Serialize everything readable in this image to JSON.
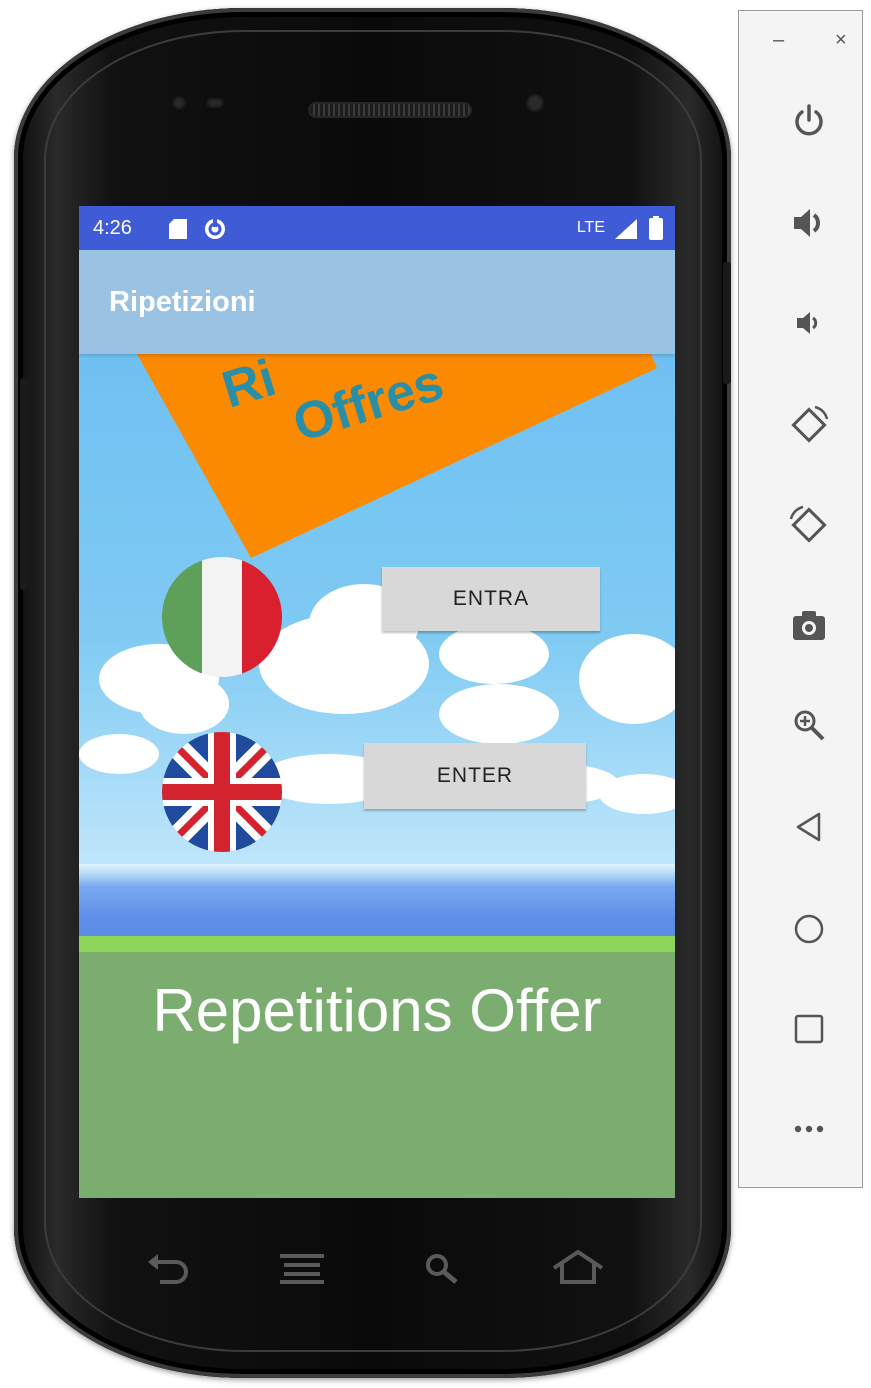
{
  "status_bar": {
    "time": "4:26",
    "network": "LTE"
  },
  "app_bar": {
    "title": "Ripetizioni"
  },
  "banner": {
    "line1": "Ri",
    "line2": "Offres"
  },
  "buttons": {
    "italian": "ENTRA",
    "english": "ENTER"
  },
  "main_text": "Repetitions Offer",
  "icons": {
    "sd_card": "sd-card-icon",
    "sync": "sync-icon",
    "signal": "signal-icon",
    "battery": "battery-icon",
    "italian_flag": "italian-flag-icon",
    "uk_flag": "uk-flag-icon"
  },
  "emulator_panel": {
    "minimize": "–",
    "close": "×",
    "tools": [
      "power",
      "volume-up",
      "volume-down",
      "rotate-left",
      "rotate-right",
      "screenshot",
      "zoom",
      "back",
      "home",
      "overview",
      "more"
    ]
  },
  "colors": {
    "status_bar": "#3f5bd6",
    "app_bar": "#9ac3e3",
    "banner": "#fb8a00",
    "banner_text": "#2a8fa6",
    "ground": "#7bad70"
  }
}
